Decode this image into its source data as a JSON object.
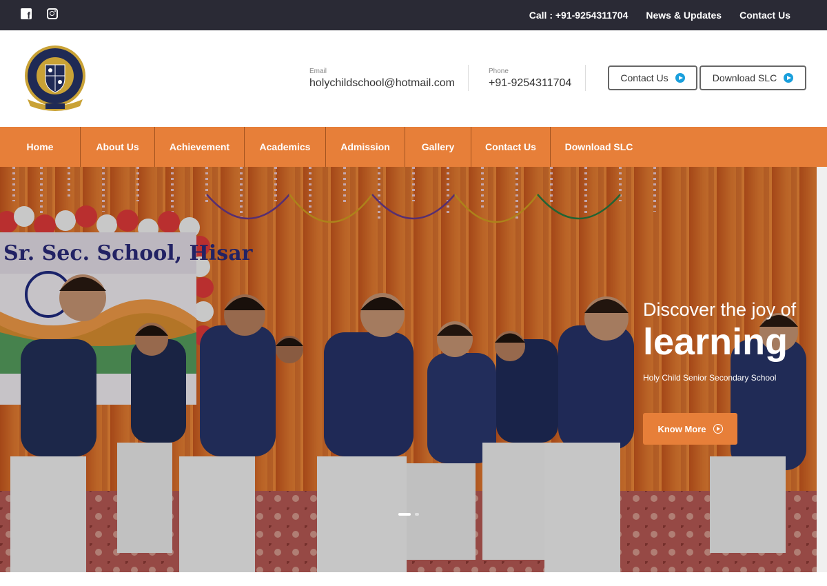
{
  "topbar": {
    "social": [
      {
        "icon": "facebook-icon"
      },
      {
        "icon": "instagram-icon"
      }
    ],
    "call": "Call : +91-9254311704",
    "news": "News & Updates",
    "contact": "Contact Us"
  },
  "header": {
    "logo_text": "HOLY CHILD SR. SEC. SCHOOL",
    "logo_year": "1988",
    "email_label": "Email",
    "email": "holychildschool@hotmail.com",
    "phone_label": "Phone",
    "phone": "+91-9254311704",
    "contact_btn": "Contact Us",
    "download_btn": "Download SLC"
  },
  "nav": [
    "Home",
    "About Us",
    "Achievement",
    "Academics",
    "Admission",
    "Gallery",
    "Contact Us",
    "Download SLC"
  ],
  "hero": {
    "banner_text": "Sr. Sec. School, Hisar",
    "line1": "Discover the joy of",
    "line2": "learning",
    "sub": "Holy Child Senior Secondary School",
    "button": "Know More"
  },
  "colors": {
    "accent": "#e77f39",
    "topbar": "#2a2a35",
    "icon_blue": "#1a9fdc"
  }
}
